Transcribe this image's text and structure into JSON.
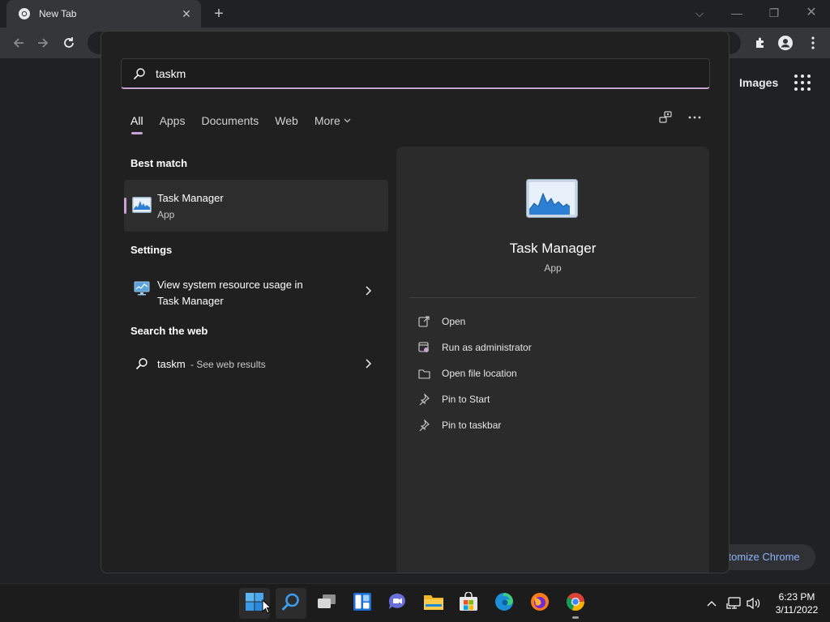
{
  "browser": {
    "tab_title": "New Tab",
    "tab_close_icon": "close-icon",
    "new_tab_icon": "plus-icon",
    "window_controls": [
      "chevron-down-icon",
      "minimize-icon",
      "restore-icon",
      "close-icon"
    ],
    "ntp": {
      "images_link": "Images",
      "customize_label": "Customize Chrome",
      "customize_visible": "stomize Chrome"
    }
  },
  "search": {
    "query": "taskm",
    "placeholder": "",
    "filters": [
      "All",
      "Apps",
      "Documents",
      "Web",
      "More"
    ],
    "active_filter": "All",
    "best_match": {
      "heading": "Best match",
      "name": "Task Manager",
      "type": "App"
    },
    "settings": {
      "heading": "Settings",
      "item_line1": "View system resource usage in",
      "item_line2": "Task Manager"
    },
    "web": {
      "heading": "Search the web",
      "query": "taskm",
      "suffix": "- See web results"
    },
    "detail": {
      "title": "Task Manager",
      "type": "App",
      "actions": [
        {
          "label": "Open",
          "icon": "open-external-icon"
        },
        {
          "label": "Run as administrator",
          "icon": "shield-admin-icon"
        },
        {
          "label": "Open file location",
          "icon": "folder-icon"
        },
        {
          "label": "Pin to Start",
          "icon": "pin-icon"
        },
        {
          "label": "Pin to taskbar",
          "icon": "pin-icon"
        }
      ]
    }
  },
  "taskbar": {
    "apps": [
      "start",
      "search",
      "task-view",
      "widgets",
      "teams-chat",
      "file-explorer",
      "microsoft-store",
      "edge",
      "firefox",
      "chrome"
    ],
    "time": "6:23 PM",
    "date": "3/11/2022"
  },
  "colors": {
    "accent": "#c7a3d4",
    "panel_bg": "#202020",
    "pane_bg": "#2b2b2b",
    "taskbar_bg": "#1c1c1c",
    "link_blue": "#8ab4f8"
  }
}
